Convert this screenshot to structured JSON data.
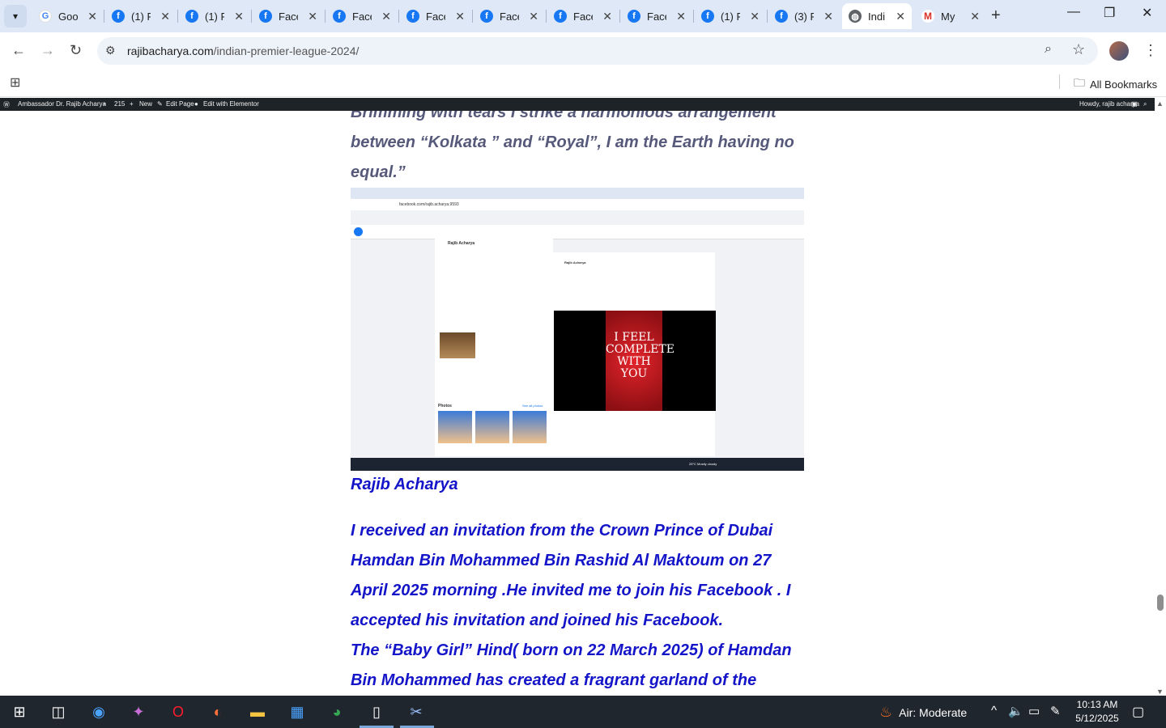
{
  "tabs": [
    {
      "icon": "google-icon",
      "title": "Goo"
    },
    {
      "icon": "facebook-icon",
      "title": "(1) F"
    },
    {
      "icon": "facebook-icon",
      "title": "(1) F"
    },
    {
      "icon": "facebook-icon",
      "title": "Face"
    },
    {
      "icon": "facebook-icon",
      "title": "Face"
    },
    {
      "icon": "facebook-icon",
      "title": "Face"
    },
    {
      "icon": "facebook-icon",
      "title": "Face"
    },
    {
      "icon": "facebook-icon",
      "title": "Face"
    },
    {
      "icon": "facebook-icon",
      "title": "Face"
    },
    {
      "icon": "facebook-icon",
      "title": "(1) F"
    },
    {
      "icon": "facebook-icon",
      "title": "(3) F"
    },
    {
      "icon": "globe-icon",
      "title": "Indi",
      "active": true
    },
    {
      "icon": "gmail-icon",
      "title": "My"
    }
  ],
  "address": {
    "domain": "rajibacharya.com",
    "path": "/indian-premier-league-2024/"
  },
  "bookmarks": {
    "all_label": "All Bookmarks"
  },
  "admin_bar": {
    "site": "Ambassador Dr. Rajib Acharya",
    "comments": "215",
    "new": "New",
    "edit_page": "Edit Page",
    "elementor": "Edit with Elementor",
    "howdy": "Howdy, rajib acharya"
  },
  "article": {
    "quote_line_1": "Brimming with tears I strike a harmonious arrangement",
    "quote_line_2": "between “Kolkata ” and “Royal”, I am the Earth having no",
    "quote_line_3": "equal.”",
    "author": "Rajib Acharya",
    "para_lines": [
      "I received an invitation from the Crown Prince of Dubai",
      "Hamdan Bin Mohammed Bin Rashid Al Maktoum on 27",
      "April 2025 morning .He invited me to join his Facebook . I",
      "accepted his invitation and joined his Facebook.",
      "The “Baby Girl” Hind( born on 22 March 2025) of Hamdan",
      "Bin Mohammed has created a fragrant garland of the"
    ]
  },
  "embedded_screenshot": {
    "url": "facebook.com/rajib.acharya.9593",
    "profile_name": "Rajib Acharya",
    "image_text": "I FEEL COMPLETE WITH YOU",
    "photos_label": "Photos",
    "see_all": "See all photos",
    "weather": "25°C Mostly cloudy"
  },
  "taskbar": {
    "weather": "Air: Moderate",
    "time": "10:13 AM",
    "date": "5/12/2025"
  }
}
